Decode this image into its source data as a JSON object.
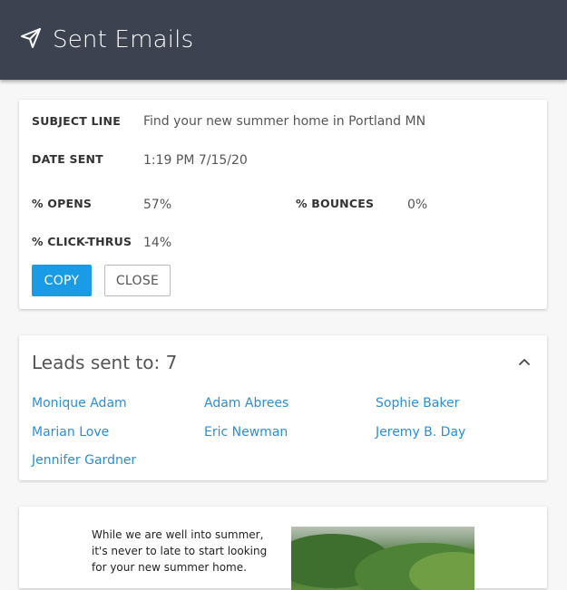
{
  "header": {
    "title": "Sent Emails",
    "icon": "paper-plane-icon"
  },
  "details": {
    "subject_label": "SUBJECT LINE",
    "subject_value": "Find your new summer home in Portland MN",
    "date_label": "DATE SENT",
    "date_value": "1:19 PM 7/15/20",
    "opens_label": "% OPENS",
    "opens_value": "57%",
    "bounces_label": "% BOUNCES",
    "bounces_value": "0%",
    "clicks_label": "% CLICK-THRUS",
    "clicks_value": "14%",
    "copy_label": "COPY",
    "close_label": "CLOSE"
  },
  "leads": {
    "title": "Leads sent to: 7",
    "items": [
      "Monique Adam",
      "Adam Abrees",
      "Sophie Baker",
      "Marian Love",
      "Eric Newman",
      "Jeremy B. Day",
      "Jennifer Gardner"
    ]
  },
  "email_preview": {
    "text": "While we are well into summer, it's never to late to start looking for your new summer home."
  },
  "colors": {
    "header_bg": "#3c4250",
    "accent": "#1a9be6",
    "link": "#2a8fd6"
  }
}
